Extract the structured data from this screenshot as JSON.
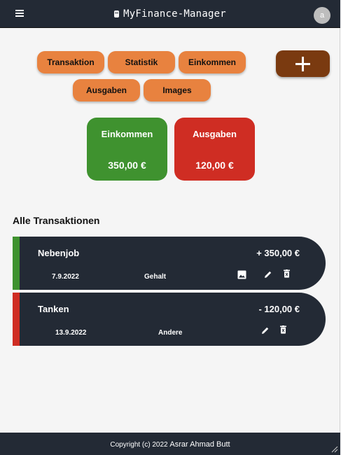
{
  "header": {
    "title": "MyFinance-Manager",
    "avatar_letter": "a"
  },
  "nav": {
    "transaktion": "Transaktion",
    "statistik": "Statistik",
    "einkommen": "Einkommen",
    "ausgaben": "Ausgaben",
    "images": "Images"
  },
  "summary": {
    "income_label": "Einkommen",
    "income_value": "350,00 €",
    "income_color": "#3f922f",
    "expense_label": "Ausgaben",
    "expense_value": "120,00 €",
    "expense_color": "#cf2d23"
  },
  "transactions_title": "Alle Transaktionen",
  "transactions": [
    {
      "name": "Nebenjob",
      "amount": "+ 350,00 €",
      "date": "7.9.2022",
      "category": "Gehalt",
      "color": "#3f922f",
      "icons": [
        "image-icon",
        "edit-icon",
        "delete-icon"
      ]
    },
    {
      "name": "Tanken",
      "amount": "- 120,00 €",
      "date": "13.9.2022",
      "category": "Andere",
      "color": "#cf2d23",
      "icons": [
        "edit-icon",
        "delete-icon"
      ]
    }
  ],
  "footer": {
    "copyright": "Copyright (c) 2022",
    "author": "Asrar Ahmad Butt"
  }
}
